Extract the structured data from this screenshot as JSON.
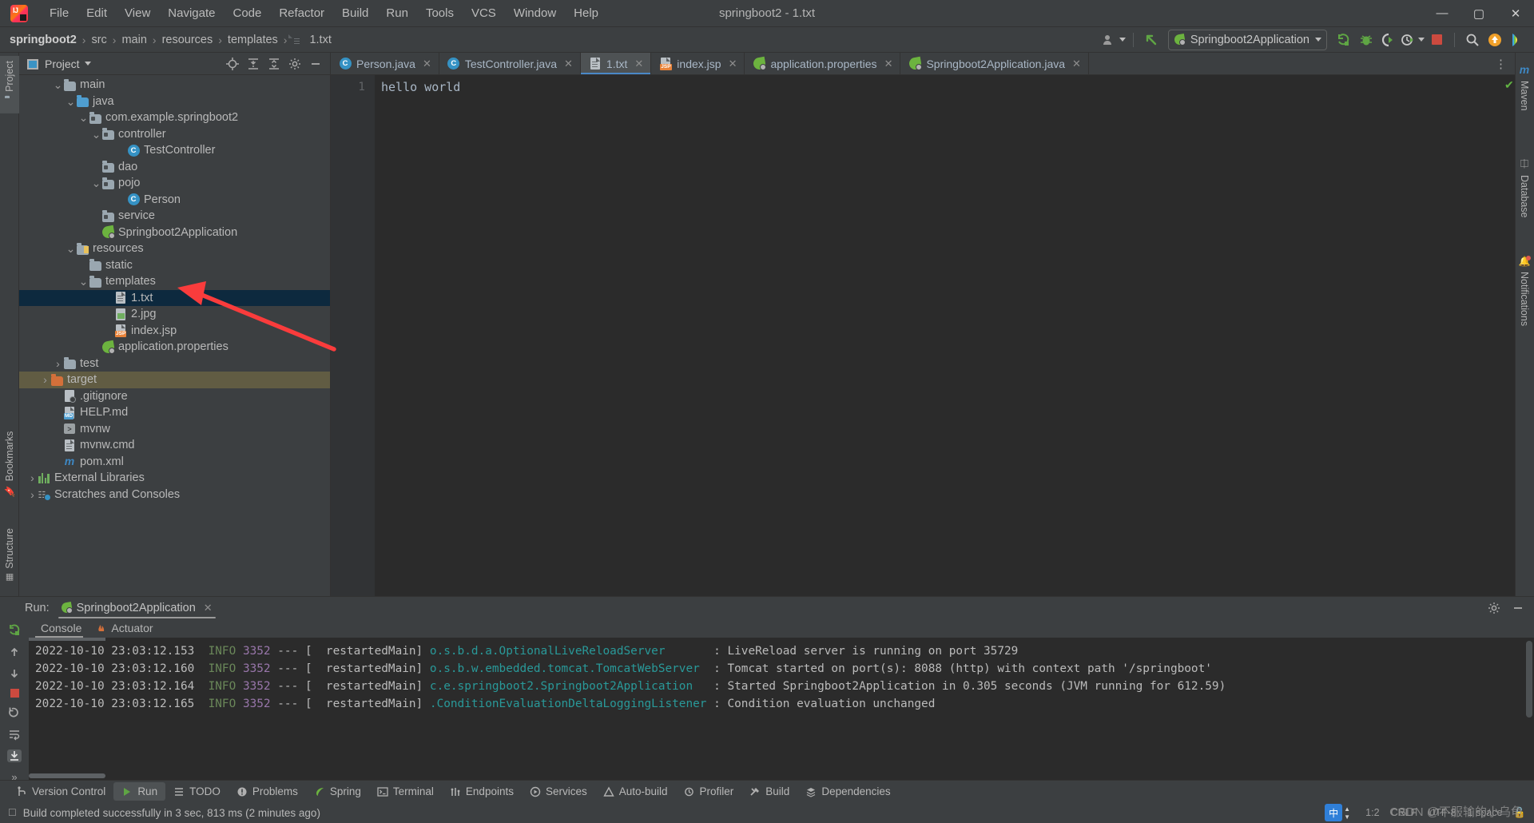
{
  "window": {
    "title": "springboot2 - 1.txt",
    "logo": "intellij-idea-logo",
    "minimize": "—",
    "maximize": "▢",
    "close": "✕"
  },
  "menu": [
    {
      "label": "File"
    },
    {
      "label": "Edit"
    },
    {
      "label": "View"
    },
    {
      "label": "Navigate"
    },
    {
      "label": "Code"
    },
    {
      "label": "Refactor"
    },
    {
      "label": "Build"
    },
    {
      "label": "Run"
    },
    {
      "label": "Tools"
    },
    {
      "label": "VCS"
    },
    {
      "label": "Window"
    },
    {
      "label": "Help"
    }
  ],
  "breadcrumb": [
    "springboot2",
    "src",
    "main",
    "resources",
    "templates",
    "1.txt"
  ],
  "toolbar": {
    "run_config": "Springboot2Application",
    "icons": [
      "user-avatar-icon",
      "updates-arrow-icon",
      "run-icon",
      "debug-icon",
      "run-with-coverage-icon",
      "profiler-icon",
      "stop-icon",
      "search-everywhere-icon",
      "updates-badge-icon",
      "ide-features-icon"
    ]
  },
  "project_panel": {
    "title": "Project",
    "header_icons": [
      "select-opened-file-icon",
      "expand-all-icon",
      "collapse-all-icon",
      "settings-gear-icon",
      "hide-icon"
    ],
    "tree": [
      {
        "label": "main",
        "indent": 2,
        "arrow": "down",
        "icon": "folder",
        "state": "normal"
      },
      {
        "label": "java",
        "indent": 3,
        "arrow": "down",
        "icon": "folder-blue",
        "state": "normal"
      },
      {
        "label": "com.example.springboot2",
        "indent": 4,
        "arrow": "down",
        "icon": "package",
        "state": "normal"
      },
      {
        "label": "controller",
        "indent": 5,
        "arrow": "down",
        "icon": "package",
        "state": "normal"
      },
      {
        "label": "TestController",
        "indent": 7,
        "arrow": "none",
        "icon": "class",
        "state": "normal"
      },
      {
        "label": "dao",
        "indent": 5,
        "arrow": "none",
        "icon": "package",
        "state": "normal"
      },
      {
        "label": "pojo",
        "indent": 5,
        "arrow": "down",
        "icon": "package",
        "state": "normal"
      },
      {
        "label": "Person",
        "indent": 7,
        "arrow": "none",
        "icon": "class",
        "state": "normal"
      },
      {
        "label": "service",
        "indent": 5,
        "arrow": "none",
        "icon": "package",
        "state": "normal"
      },
      {
        "label": "Springboot2Application",
        "indent": 5,
        "arrow": "none",
        "icon": "spring-class",
        "state": "normal"
      },
      {
        "label": "resources",
        "indent": 3,
        "arrow": "down",
        "icon": "folder-resources",
        "state": "normal"
      },
      {
        "label": "static",
        "indent": 4,
        "arrow": "none",
        "icon": "folder",
        "state": "normal"
      },
      {
        "label": "templates",
        "indent": 4,
        "arrow": "down",
        "icon": "folder",
        "state": "normal"
      },
      {
        "label": "1.txt",
        "indent": 6,
        "arrow": "none",
        "icon": "text-file",
        "state": "selected"
      },
      {
        "label": "2.jpg",
        "indent": 6,
        "arrow": "none",
        "icon": "image-file",
        "state": "normal"
      },
      {
        "label": "index.jsp",
        "indent": 6,
        "arrow": "none",
        "icon": "jsp-file",
        "state": "normal"
      },
      {
        "label": "application.properties",
        "indent": 5,
        "arrow": "none",
        "icon": "spring-properties",
        "state": "normal"
      },
      {
        "label": "test",
        "indent": 2,
        "arrow": "right",
        "icon": "folder",
        "state": "normal"
      },
      {
        "label": "target",
        "indent": 1,
        "arrow": "right",
        "icon": "folder-orange",
        "state": "highlighted"
      },
      {
        "label": ".gitignore",
        "indent": 2,
        "arrow": "none",
        "icon": "gitignore-file",
        "state": "normal"
      },
      {
        "label": "HELP.md",
        "indent": 2,
        "arrow": "none",
        "icon": "markdown-file",
        "state": "normal"
      },
      {
        "label": "mvnw",
        "indent": 2,
        "arrow": "none",
        "icon": "shell-file",
        "state": "normal"
      },
      {
        "label": "mvnw.cmd",
        "indent": 2,
        "arrow": "none",
        "icon": "cmd-file",
        "state": "normal"
      },
      {
        "label": "pom.xml",
        "indent": 2,
        "arrow": "none",
        "icon": "maven-file",
        "state": "normal"
      },
      {
        "label": "External Libraries",
        "indent": 0,
        "arrow": "right",
        "icon": "libraries",
        "state": "normal"
      },
      {
        "label": "Scratches and Consoles",
        "indent": 0,
        "arrow": "right",
        "icon": "scratches",
        "state": "normal"
      }
    ]
  },
  "left_strip": [
    {
      "label": "Project"
    },
    {
      "label": "Bookmarks"
    },
    {
      "label": "Structure"
    }
  ],
  "right_strip": [
    {
      "label": "Maven"
    },
    {
      "label": "Database"
    },
    {
      "label": "Notifications"
    }
  ],
  "editor": {
    "tabs": [
      {
        "label": "Person.java",
        "icon": "java-class-icon",
        "active": false
      },
      {
        "label": "TestController.java",
        "icon": "java-class-icon",
        "active": false
      },
      {
        "label": "1.txt",
        "icon": "text-file-icon",
        "active": true
      },
      {
        "label": "index.jsp",
        "icon": "jsp-file-icon",
        "active": false
      },
      {
        "label": "application.properties",
        "icon": "spring-properties-icon",
        "active": false
      },
      {
        "label": "Springboot2Application.java",
        "icon": "spring-class-icon",
        "active": false
      }
    ],
    "gutter_lines": [
      "1"
    ],
    "content": [
      "hello world"
    ],
    "inspection_status": "✔"
  },
  "run_panel": {
    "label": "Run:",
    "config_name": "Springboot2Application",
    "console_tabs": [
      {
        "label": "Console",
        "icon": "console-icon",
        "active": true
      },
      {
        "label": "Actuator",
        "icon": "actuator-icon",
        "active": false
      }
    ],
    "side_tools": [
      "rerun-icon",
      "scroll-up-icon",
      "scroll-down-icon",
      "stop-icon",
      "restart-icon",
      "soft-wrap-icon",
      "scroll-to-end-icon",
      "more-icon"
    ],
    "header_right_icons": [
      "settings-gear-icon",
      "hide-icon"
    ],
    "log_lines": [
      {
        "timestamp": "2022-10-10 23:03:12.153",
        "level": "INFO",
        "pid": "3352",
        "sep": "---",
        "thread": "[  restartedMain]",
        "logger": "o.s.b.d.a.OptionalLiveReloadServer",
        "message": ": LiveReload server is running on port 35729"
      },
      {
        "timestamp": "2022-10-10 23:03:12.160",
        "level": "INFO",
        "pid": "3352",
        "sep": "---",
        "thread": "[  restartedMain]",
        "logger": "o.s.b.w.embedded.tomcat.TomcatWebServer",
        "message": ": Tomcat started on port(s): 8088 (http) with context path '/springboot'"
      },
      {
        "timestamp": "2022-10-10 23:03:12.164",
        "level": "INFO",
        "pid": "3352",
        "sep": "---",
        "thread": "[  restartedMain]",
        "logger": "c.e.springboot2.Springboot2Application",
        "message": ": Started Springboot2Application in 0.305 seconds (JVM running for 612.59)"
      },
      {
        "timestamp": "2022-10-10 23:03:12.165",
        "level": "INFO",
        "pid": "3352",
        "sep": "---",
        "thread": "[  restartedMain]",
        "logger": ".ConditionEvaluationDeltaLoggingListener",
        "message": ": Condition evaluation unchanged"
      }
    ]
  },
  "bottom_tabs": [
    {
      "label": "Version Control",
      "icon": "branch-icon",
      "active": false
    },
    {
      "label": "Run",
      "icon": "run-icon",
      "active": true
    },
    {
      "label": "TODO",
      "icon": "todo-icon",
      "active": false
    },
    {
      "label": "Problems",
      "icon": "problems-icon",
      "active": false
    },
    {
      "label": "Spring",
      "icon": "spring-leaf-icon",
      "active": false
    },
    {
      "label": "Terminal",
      "icon": "terminal-icon",
      "active": false
    },
    {
      "label": "Endpoints",
      "icon": "endpoints-icon",
      "active": false
    },
    {
      "label": "Services",
      "icon": "services-icon",
      "active": false
    },
    {
      "label": "Auto-build",
      "icon": "auto-build-icon",
      "active": false
    },
    {
      "label": "Profiler",
      "icon": "profiler-icon",
      "active": false
    },
    {
      "label": "Build",
      "icon": "build-hammer-icon",
      "active": false
    },
    {
      "label": "Dependencies",
      "icon": "dependencies-icon",
      "active": false
    }
  ],
  "status_bar": {
    "message": "Build completed successfully in 3 sec, 813 ms (2 minutes ago)",
    "caret_position": "1:2",
    "line_separator": "CRLF",
    "encoding": "UTF-8",
    "indent": "1 space",
    "ime_badge": "中"
  },
  "watermark": "CSDN @不服输的小乌龟",
  "annotation": {
    "type": "red-arrow",
    "color": "#fa3c3c",
    "points": "from (420,440) to (228,362)"
  },
  "colors": {
    "window_bg": "#3c3f41",
    "editor_bg": "#2b2b2b",
    "selection_blue": "#0d293e",
    "target_highlight": "#615c43",
    "tab_underline": "#4a88c7",
    "accent_green": "#6cb33f",
    "annotation_red": "#fa3c3c"
  }
}
